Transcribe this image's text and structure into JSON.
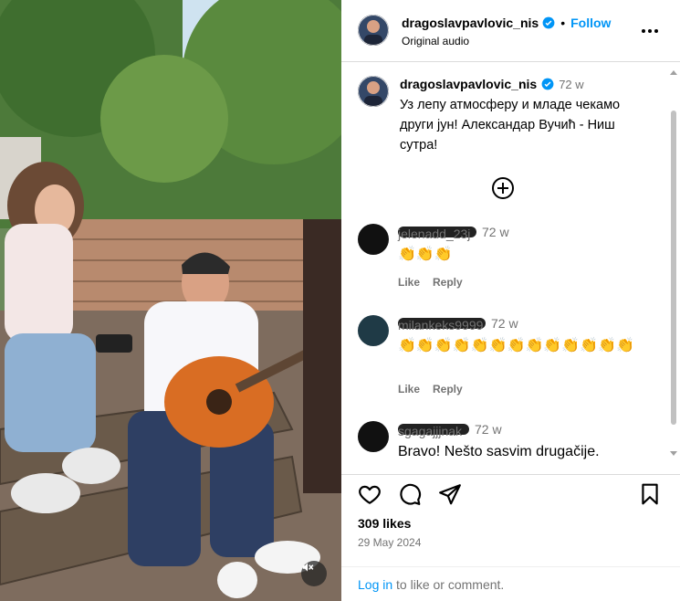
{
  "header": {
    "username": "dragoslavpavlovic_nis",
    "separator": "•",
    "follow_label": "Follow",
    "audio_label": "Original audio"
  },
  "caption": {
    "username": "dragoslavpavlovic_nis",
    "time": "72 w",
    "text": "Уз лепу атмосферу и младе чекамо други јун! Александар Вучић - Ниш сутра!"
  },
  "comments": [
    {
      "username": "jelenadd_23j",
      "time": "72 w",
      "text": "👏👏👏",
      "like_label": "Like",
      "reply_label": "Reply"
    },
    {
      "username": "milankeks9999",
      "time": "72 w",
      "text": "👏👏👏👏👏👏👏👏👏👏👏👏👏",
      "like_label": "Like",
      "reply_label": "Reply"
    },
    {
      "username": "sgagajjjnak",
      "time": "72 w",
      "text": "Bravo! Nešto sasvim drugačije.",
      "like_label": "Like",
      "reply_label": "Reply"
    }
  ],
  "post": {
    "likes": "309 likes",
    "date": "29 May 2024"
  },
  "login_prompt": {
    "login_label": "Log in",
    "suffix": " to like or comment."
  },
  "icons": {
    "verified": "verified-badge-icon",
    "more": "more-options-icon",
    "add": "add-circle-icon",
    "heart": "heart-icon",
    "comment": "comment-icon",
    "share": "share-icon",
    "save": "bookmark-icon",
    "mute": "muted-speaker-icon"
  },
  "colors": {
    "accent": "#0095f6",
    "secondary_text": "#737373",
    "verified": "#0095f6"
  }
}
